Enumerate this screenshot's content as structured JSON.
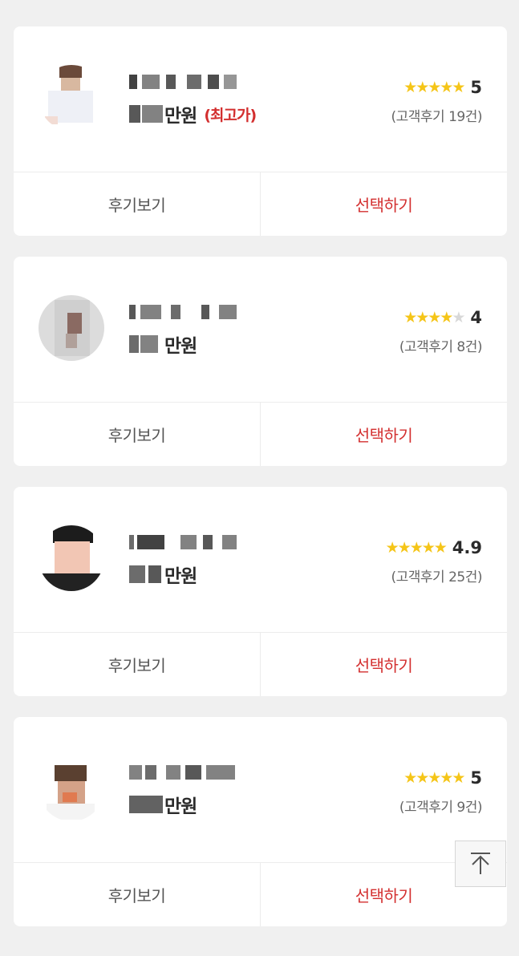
{
  "colors": {
    "accent": "#d32f2f",
    "star": "#f5c518",
    "star_empty": "#d8d8d8",
    "background": "#f0f0f0"
  },
  "cards": [
    {
      "price_unit": "만원",
      "price_tag": "(최고가)",
      "stars_filled": 5,
      "stars_total": 5,
      "score": "5",
      "review_count": "(고객후기 19건)",
      "review_button": "후기보기",
      "select_button": "선택하기"
    },
    {
      "price_unit": "만원",
      "price_tag": "",
      "stars_filled": 4,
      "stars_total": 5,
      "score": "4",
      "review_count": "(고객후기 8건)",
      "review_button": "후기보기",
      "select_button": "선택하기"
    },
    {
      "price_unit": "만원",
      "price_tag": "",
      "stars_filled": 5,
      "stars_total": 5,
      "score": "4.9",
      "review_count": "(고객후기 25건)",
      "review_button": "후기보기",
      "select_button": "선택하기"
    },
    {
      "price_unit": "만원",
      "price_tag": "",
      "stars_filled": 5,
      "stars_total": 5,
      "score": "5",
      "review_count": "(고객후기 9건)",
      "review_button": "후기보기",
      "select_button": "선택하기"
    }
  ],
  "scroll_top": {
    "icon": "arrow-up-to-top-icon"
  }
}
